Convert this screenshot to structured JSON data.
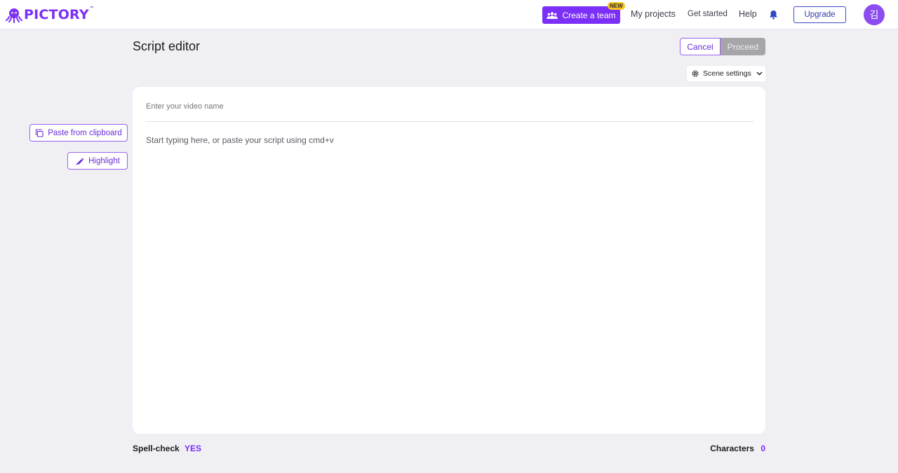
{
  "brand": {
    "name": "PICTORY",
    "tm": "™",
    "accent": "#7b2ff7"
  },
  "header": {
    "create_team_label": "Create a team",
    "new_badge": "NEW",
    "nav": [
      "My projects",
      "Get started",
      "Help"
    ],
    "upgrade_label": "Upgrade",
    "avatar_initial": "김",
    "icons": {
      "team": "people-icon",
      "notifications": "bell-icon"
    }
  },
  "page": {
    "title": "Script editor",
    "cancel_label": "Cancel",
    "proceed_label": "Proceed",
    "scene_settings_label": "Scene settings"
  },
  "tools": {
    "paste_label": "Paste from clipboard",
    "highlight_label": "Highlight"
  },
  "editor": {
    "name_placeholder": "Enter your video name",
    "script_placeholder": "Start typing here, or paste your script using cmd+v"
  },
  "footer": {
    "spellcheck_label": "Spell-check",
    "spellcheck_value": "YES",
    "characters_label": "Characters",
    "characters_value": "0"
  }
}
